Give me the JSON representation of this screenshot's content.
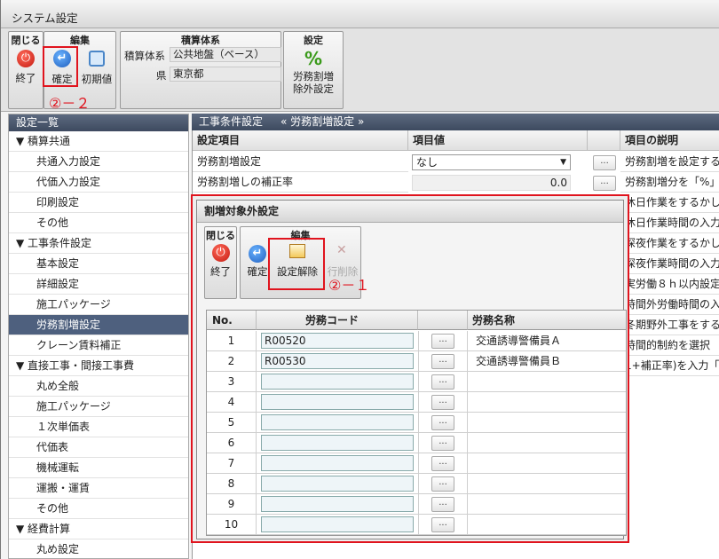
{
  "window": {
    "title": "システム設定"
  },
  "toolbar": {
    "close_group": {
      "header": "閉じる",
      "exit_label": "終了"
    },
    "edit_group": {
      "header": "編集",
      "confirm_label": "確定",
      "reset_label": "初期値"
    },
    "accounting_group": {
      "header": "積算体系",
      "system_label": "積算体系",
      "system_value": "公共地盤（ベース）",
      "pref_label": "県",
      "pref_value": "東京都"
    },
    "settings_group": {
      "header": "設定",
      "labor_button_line1": "労務割増",
      "labor_button_line2": "除外設定"
    },
    "annotation": "②－２"
  },
  "sidebar": {
    "header": "設定一覧",
    "items": [
      {
        "label": "▼ 積算共通",
        "level": "parent",
        "selected": false
      },
      {
        "label": "共通入力設定",
        "level": "child",
        "selected": false
      },
      {
        "label": "代価入力設定",
        "level": "child",
        "selected": false
      },
      {
        "label": "印刷設定",
        "level": "child",
        "selected": false
      },
      {
        "label": "その他",
        "level": "child",
        "selected": false
      },
      {
        "label": "▼ 工事条件設定",
        "level": "parent",
        "selected": false
      },
      {
        "label": "基本設定",
        "level": "child",
        "selected": false
      },
      {
        "label": "詳細設定",
        "level": "child",
        "selected": false
      },
      {
        "label": "施工パッケージ",
        "level": "child",
        "selected": false
      },
      {
        "label": "労務割増設定",
        "level": "child",
        "selected": true
      },
      {
        "label": "クレーン賃料補正",
        "level": "child",
        "selected": false
      },
      {
        "label": "▼ 直接工事・間接工事費",
        "level": "parent",
        "selected": false
      },
      {
        "label": "丸め全般",
        "level": "child",
        "selected": false
      },
      {
        "label": "施工パッケージ",
        "level": "child",
        "selected": false
      },
      {
        "label": "１次単価表",
        "level": "child",
        "selected": false
      },
      {
        "label": "代価表",
        "level": "child",
        "selected": false
      },
      {
        "label": "機械運転",
        "level": "child",
        "selected": false
      },
      {
        "label": "運搬・運賃",
        "level": "child",
        "selected": false
      },
      {
        "label": "その他",
        "level": "child",
        "selected": false
      },
      {
        "label": "▼ 経費計算",
        "level": "parent",
        "selected": false
      },
      {
        "label": "丸め設定",
        "level": "child",
        "selected": false
      }
    ]
  },
  "main": {
    "section": "工事条件設定",
    "subsection": "« 労務割増設定 »",
    "columns": {
      "item": "設定項目",
      "value": "項目値",
      "desc": "項目の説明"
    },
    "rows": [
      {
        "item": "労務割増設定",
        "value": "なし",
        "desc": "労務割増を設定する"
      },
      {
        "item": "労務割増しの補正率",
        "value": "0.0",
        "desc": "労務割増分を「%」"
      }
    ],
    "desc_overflow": [
      "休日作業をするかし",
      "休日作業時間の入力",
      "深夜作業をするかし",
      "深夜作業時間の入力",
      "実労働８ｈ以内設定",
      "時間外労働時間の入",
      "冬期野外工事をする",
      "時間的制約を選択",
      "1+補正率)を入力「"
    ],
    "dots_label": "..."
  },
  "dialog": {
    "title": "割増対象外設定",
    "close_header": "閉じる",
    "exit_label": "終了",
    "edit_header": "編集",
    "confirm_label": "確定",
    "clear_label": "設定解除",
    "delete_row_label": "行削除",
    "annotation": "②－１",
    "columns": {
      "no": "No.",
      "code": "労務コード",
      "name": "労務名称"
    },
    "dots_label": "...",
    "rows": [
      {
        "no": "1",
        "code": "R00520",
        "name": "交通誘導警備員Ａ"
      },
      {
        "no": "2",
        "code": "R00530",
        "name": "交通誘導警備員Ｂ"
      },
      {
        "no": "3",
        "code": "",
        "name": ""
      },
      {
        "no": "4",
        "code": "",
        "name": ""
      },
      {
        "no": "5",
        "code": "",
        "name": ""
      },
      {
        "no": "6",
        "code": "",
        "name": ""
      },
      {
        "no": "7",
        "code": "",
        "name": ""
      },
      {
        "no": "8",
        "code": "",
        "name": ""
      },
      {
        "no": "9",
        "code": "",
        "name": ""
      },
      {
        "no": "10",
        "code": "",
        "name": ""
      }
    ]
  },
  "colors": {
    "accent_red": "#e0141e",
    "header_bg": "#4e607e",
    "selected_bg": "#4e607e"
  }
}
